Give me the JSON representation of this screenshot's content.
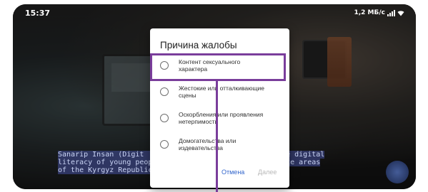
{
  "status_bar": {
    "time": "15:37",
    "network_speed": "1,2 МБ/с"
  },
  "video": {
    "subtitles": [
      "Sanarip Insan (Digit                          ving the digital",
      "literacy of young peop                        of remote areas",
      "of the Kyrgyz Republic"
    ]
  },
  "dialog": {
    "title": "Причина жалобы",
    "options": [
      {
        "label_line1": "Контент сексуального",
        "label_line2": "характера"
      },
      {
        "label_line1": "Жестокие или отталкивающие",
        "label_line2": "сцены"
      },
      {
        "label_line1": "Оскорбления или проявления",
        "label_line2": "нетерпимости"
      },
      {
        "label_line1": "Домогательства или",
        "label_line2": "издевательства"
      }
    ],
    "cancel_label": "Отмена",
    "next_label": "Далее"
  },
  "colors": {
    "highlight": "#7a3d9b",
    "link": "#3366cc",
    "disabled": "#b8b8b8"
  }
}
